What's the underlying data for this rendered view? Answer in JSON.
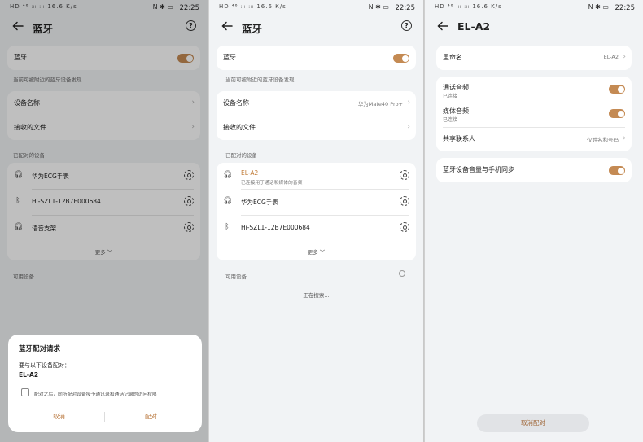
{
  "status": {
    "left": "HD ⁴⁶ ᵢₗₗ ᵢₗₗ 16.6 K/s",
    "icons": "N ✱ ▭",
    "time": "22:25"
  },
  "screen1": {
    "title": "蓝牙",
    "help": "?",
    "bluetooth_label": "蓝牙",
    "visible_hint": "当前可被附近的蓝牙设备发现",
    "device_name_label": "设备名称",
    "received_files_label": "接收的文件",
    "paired_header": "已配对的设备",
    "paired": [
      {
        "name": "华为ECG手表",
        "icon": "headphone-icon"
      },
      {
        "name": "Hi-SZL1-12B7E000684",
        "icon": "bluetooth-icon"
      },
      {
        "name": "语音支架",
        "icon": "headphone-icon"
      }
    ],
    "more": "更多 ﹀",
    "available_header": "可用设备",
    "dialog": {
      "title": "蓝牙配对请求",
      "message": "要与以下设备配对：",
      "device": "EL-A2",
      "checkbox_text": "配对之后，向所配对设备授予通讯录和通话记录的访问权限",
      "cancel": "取消",
      "pair": "配对"
    }
  },
  "screen2": {
    "title": "蓝牙",
    "help": "?",
    "bluetooth_label": "蓝牙",
    "visible_hint": "当前可被附近的蓝牙设备发现",
    "device_name_label": "设备名称",
    "device_name_value": "华为Mate40 Pro+",
    "received_files_label": "接收的文件",
    "paired_header": "已配对的设备",
    "paired": [
      {
        "name": "EL-A2",
        "sub": "已连接用于通话和媒体的音频",
        "icon": "headphone-icon",
        "active": true
      },
      {
        "name": "华为ECG手表",
        "sub": "",
        "icon": "headphone-icon",
        "active": false
      },
      {
        "name": "Hi-SZL1-12B7E000684",
        "sub": "",
        "icon": "bluetooth-icon",
        "active": false
      }
    ],
    "more": "更多 ﹀",
    "available_header": "可用设备",
    "searching": "正在搜索..."
  },
  "screen3": {
    "title": "EL-A2",
    "rename_label": "重命名",
    "rename_value": "EL-A2",
    "call_audio_label": "通话音频",
    "call_audio_sub": "已连接",
    "media_audio_label": "媒体音频",
    "media_audio_sub": "已连接",
    "contacts_label": "共享联系人",
    "contacts_value": "仅姓名和号码",
    "volume_sync_label": "蓝牙设备音量与手机同步",
    "unpair": "取消配对"
  },
  "colors": {
    "accent": "#c48a53",
    "active_text": "#c07a35",
    "card": "#ffffff",
    "bg": "#f1f3f5"
  }
}
